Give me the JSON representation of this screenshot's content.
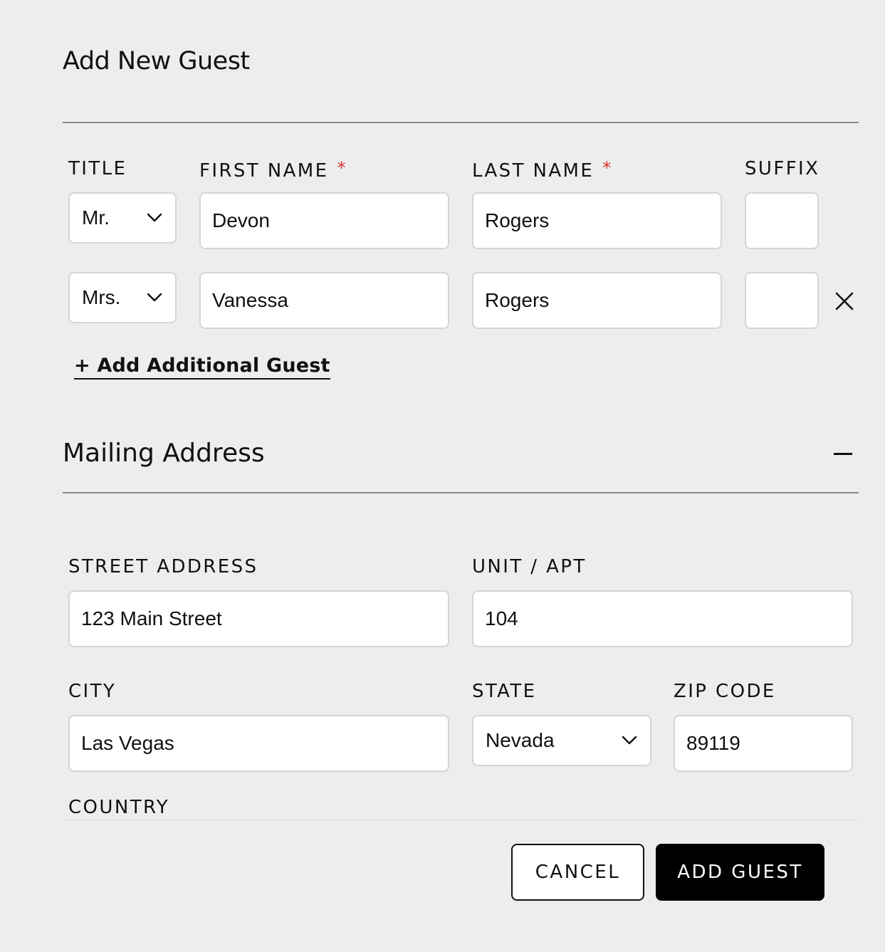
{
  "dialog": {
    "title": "Add New Guest"
  },
  "guests": {
    "labels": {
      "title": "TITLE",
      "first_name": "FIRST NAME",
      "last_name": "LAST NAME",
      "suffix": "SUFFIX",
      "required_mark": "*"
    },
    "rows": [
      {
        "title": "Mr.",
        "first_name": "Devon",
        "last_name": "Rogers",
        "suffix": ""
      },
      {
        "title": "Mrs.",
        "first_name": "Vanessa",
        "last_name": "Rogers",
        "suffix": ""
      }
    ],
    "add_link": "+ Add Additional Guest"
  },
  "mailing": {
    "title": "Mailing Address",
    "labels": {
      "street": "STREET ADDRESS",
      "unit": "UNIT / APT",
      "city": "CITY",
      "state": "STATE",
      "zip": "ZIP CODE",
      "country": "COUNTRY"
    },
    "values": {
      "street": "123 Main Street",
      "unit": "104",
      "city": "Las Vegas",
      "state": "Nevada",
      "zip": "89119"
    }
  },
  "actions": {
    "cancel": "CANCEL",
    "submit": "ADD GUEST"
  },
  "icons": {
    "dropdown": "chevron-down-icon",
    "remove_guest": "close-icon",
    "collapse_section": "minus-icon"
  },
  "colors": {
    "background": "#ededed",
    "required": "#d6332c",
    "primary_button": "#000000"
  }
}
